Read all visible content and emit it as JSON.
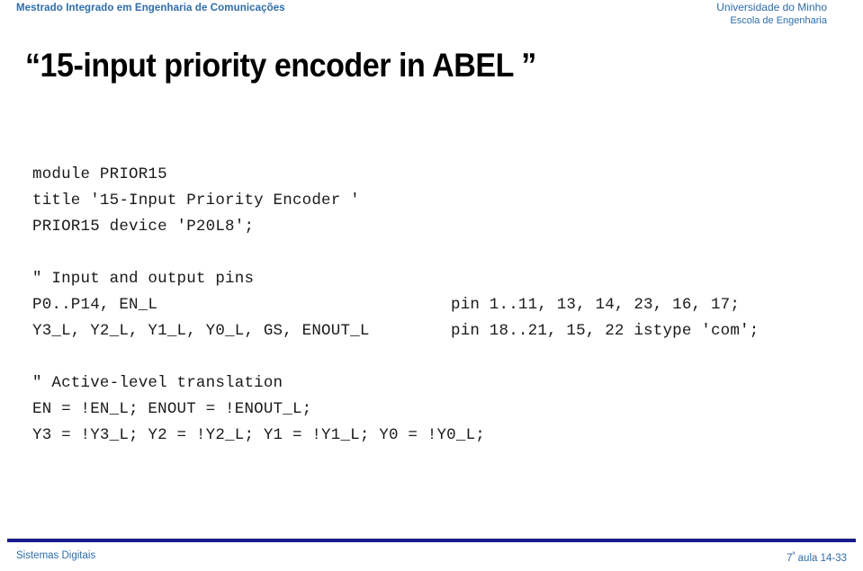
{
  "header": {
    "course": "Mestrado Integrado em Engenharia de Comunicações",
    "university_line1": "Universidade do Minho",
    "university_line2": "Escola de Engenharia"
  },
  "title": "“15-input priority encoder in ABEL ”",
  "code": {
    "language": "ABEL",
    "lines": [
      {
        "left": "module PRIOR15",
        "right": ""
      },
      {
        "left": "title '15-Input Priority Encoder '",
        "right": ""
      },
      {
        "left": "PRIOR15 device 'P20L8';",
        "right": ""
      },
      {
        "left": "",
        "right": ""
      },
      {
        "left": "\" Input and output pins",
        "right": ""
      },
      {
        "left": "P0..P14, EN_L",
        "right": "pin 1..11, 13, 14, 23, 16, 17;"
      },
      {
        "left": "Y3_L, Y2_L, Y1_L, Y0_L, GS, ENOUT_L",
        "right": "pin 18..21, 15, 22 istype 'com';"
      },
      {
        "left": "",
        "right": ""
      },
      {
        "left": "\" Active-level translation",
        "right": ""
      },
      {
        "left": "EN = !EN_L; ENOUT = !ENOUT_L;",
        "right": ""
      },
      {
        "left": "Y3 = !Y3_L; Y2 = !Y2_L; Y1 = !Y1_L; Y0 = !Y0_L;",
        "right": ""
      }
    ]
  },
  "footer": {
    "left": "Sistemas Digitais",
    "right_ordinal_number": "7",
    "right_ordinal_suffix": "ª",
    "right_rest": " aula 14-33"
  },
  "colors": {
    "accent_blue": "#2E6DA8",
    "rule_navy": "#1A1A8C",
    "text_black": "#000000",
    "background": "#FFFFFF"
  }
}
